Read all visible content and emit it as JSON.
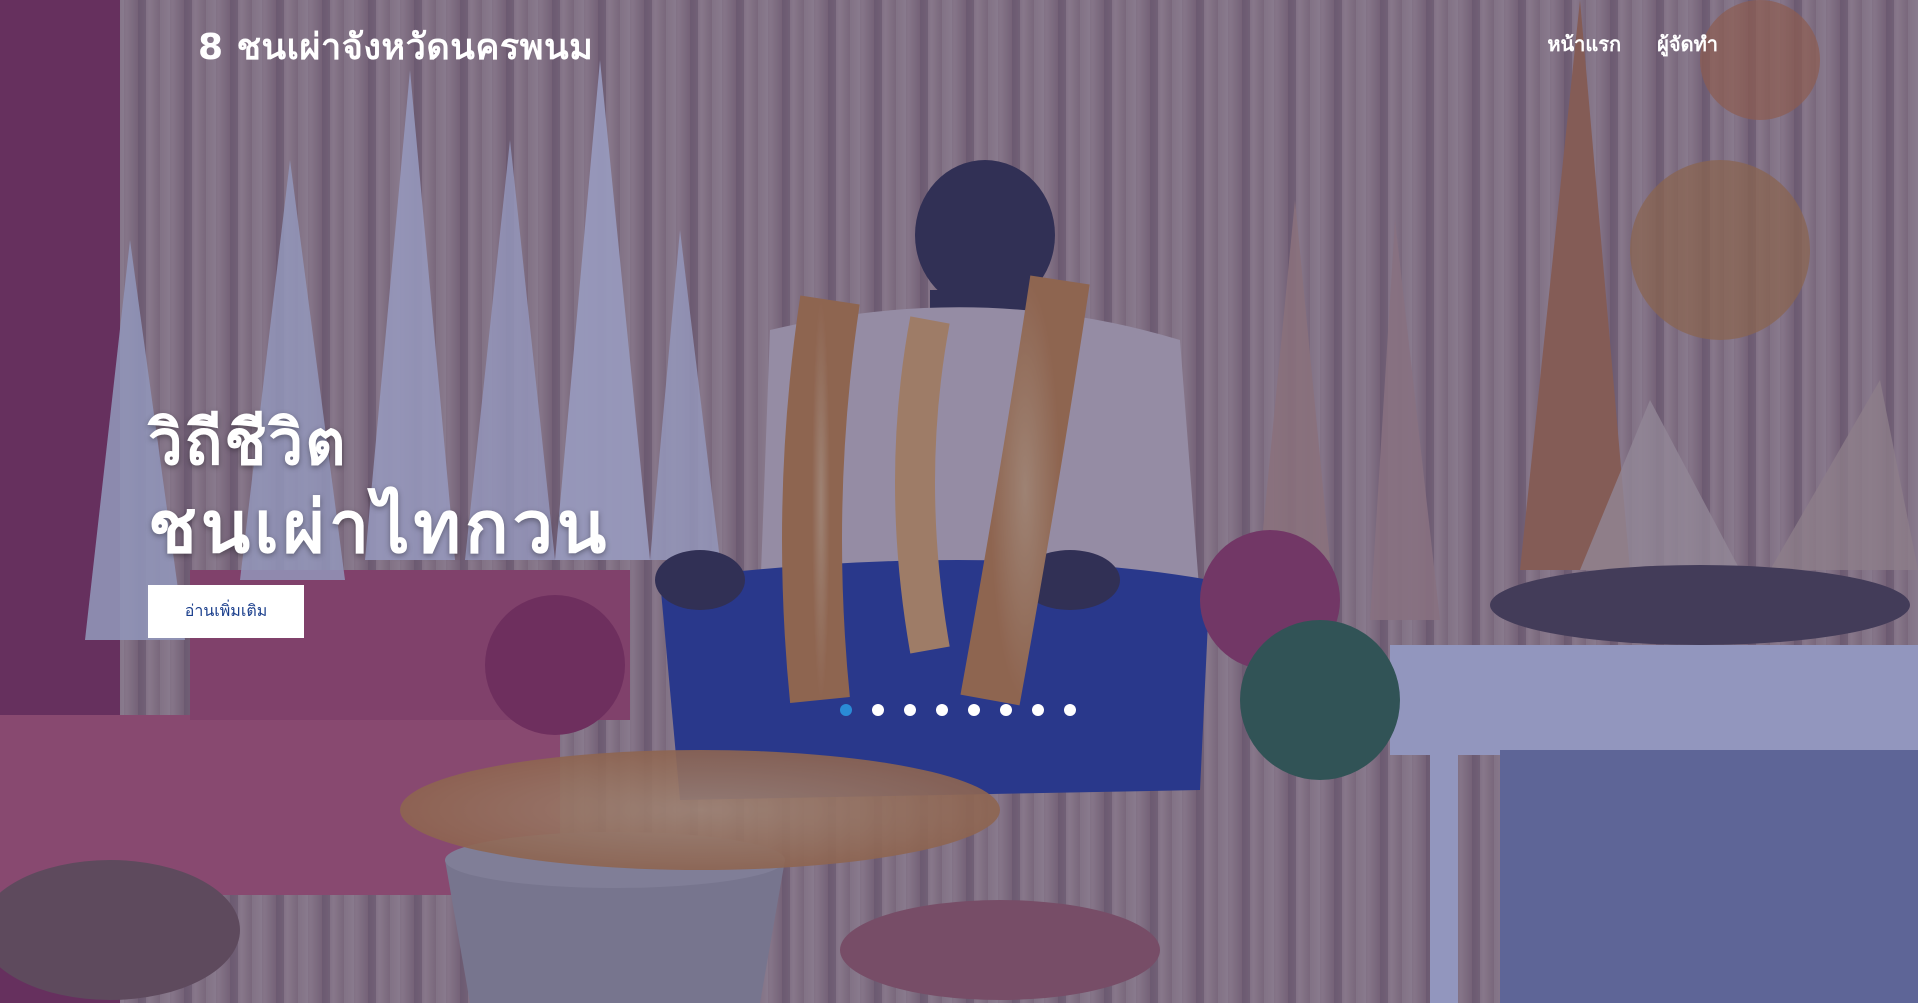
{
  "navbar": {
    "brand": "8 ชนเผ่าจังหวัดนครพนม",
    "links": [
      "หน้าแรก",
      "ผู้จัดทำ"
    ]
  },
  "hero": {
    "line1": "วิถีชีวิต",
    "line2": "ชนเผ่าไทกวน",
    "button_label": "อ่านเพิ่มเติม",
    "image": "photo-tribal-shrine-statue-with-marigold-garlands",
    "overlay_color": "#28378c"
  },
  "carousel": {
    "total_slides": 8,
    "active_index": 0,
    "active_color": "#2a8bd6",
    "inactive_color": "#ffffff"
  }
}
